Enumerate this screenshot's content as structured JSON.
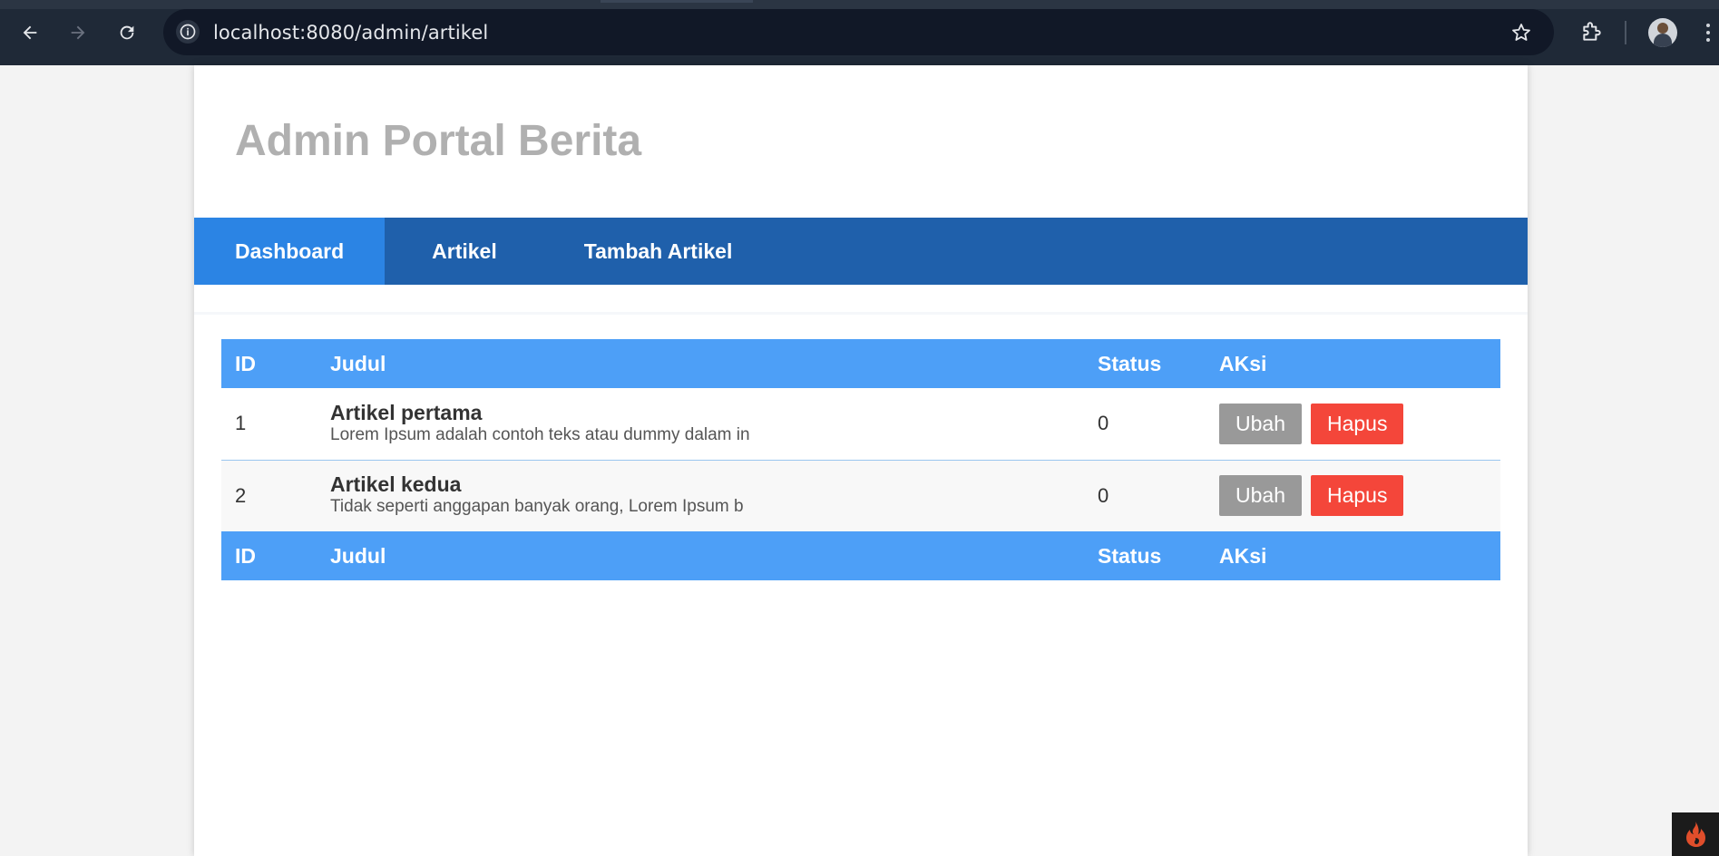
{
  "browser": {
    "url": "localhost:8080/admin/artikel"
  },
  "site": {
    "title": "Admin Portal Berita"
  },
  "nav": {
    "items": [
      {
        "label": "Dashboard",
        "active": true
      },
      {
        "label": "Artikel",
        "active": false
      },
      {
        "label": "Tambah Artikel",
        "active": false
      }
    ]
  },
  "table": {
    "headers": [
      "ID",
      "Judul",
      "Status",
      "AKsi"
    ],
    "footers": [
      "ID",
      "Judul",
      "Status",
      "AKsi"
    ],
    "rows": [
      {
        "id": "1",
        "title": "Artikel pertama",
        "excerpt": "Lorem Ipsum adalah contoh teks atau dummy dalam in",
        "status": "0",
        "edit_label": "Ubah",
        "delete_label": "Hapus"
      },
      {
        "id": "2",
        "title": "Artikel kedua",
        "excerpt": "Tidak seperti anggapan banyak orang, Lorem Ipsum b",
        "status": "0",
        "edit_label": "Ubah",
        "delete_label": "Hapus"
      }
    ]
  },
  "colors": {
    "nav_bg": "#1f60ab",
    "nav_active": "#2b84e4",
    "table_header": "#4d9ff7",
    "edit_button": "#999999",
    "delete_button": "#f4463a",
    "title_text": "#b0b0b0"
  },
  "icons": {
    "back": "arrow-left-icon",
    "forward": "arrow-right-icon",
    "reload": "reload-icon",
    "info": "info-icon",
    "bookmark": "star-icon",
    "extensions": "puzzle-icon",
    "menu": "more-vertical-icon",
    "debug": "codeigniter-flame-icon"
  }
}
